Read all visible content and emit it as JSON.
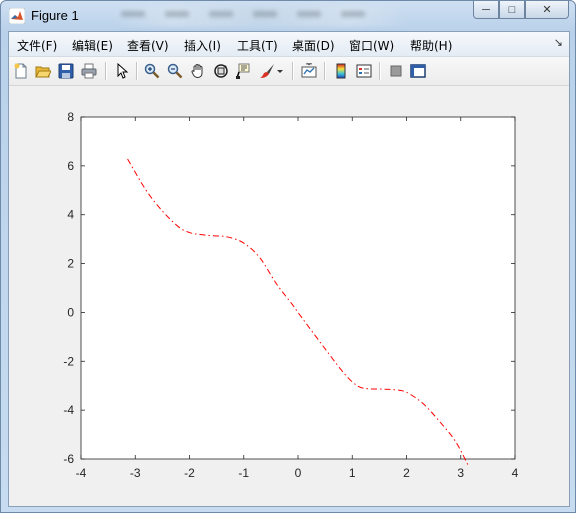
{
  "window": {
    "title": "Figure 1",
    "controls": {
      "minimize": "─",
      "maximize": "□",
      "close": "✕"
    }
  },
  "menubar": {
    "items": [
      {
        "label": "文件(F)"
      },
      {
        "label": "编辑(E)"
      },
      {
        "label": "查看(V)"
      },
      {
        "label": "插入(I)"
      },
      {
        "label": "工具(T)"
      },
      {
        "label": "桌面(D)"
      },
      {
        "label": "窗口(W)"
      },
      {
        "label": "帮助(H)"
      }
    ]
  },
  "toolbar": {
    "buttons": [
      {
        "icon": "new-figure-icon"
      },
      {
        "icon": "open-file-icon"
      },
      {
        "icon": "save-icon"
      },
      {
        "icon": "print-icon"
      },
      {
        "icon": "pointer-icon"
      },
      {
        "icon": "zoom-in-icon"
      },
      {
        "icon": "zoom-out-icon"
      },
      {
        "icon": "pan-hand-icon"
      },
      {
        "icon": "rotate-3d-icon"
      },
      {
        "icon": "data-cursor-icon"
      },
      {
        "icon": "brush-icon"
      },
      {
        "icon": "link-plot-icon"
      },
      {
        "icon": "colorbar-icon"
      },
      {
        "icon": "legend-icon"
      },
      {
        "icon": "hide-plot-tools-icon"
      },
      {
        "icon": "show-plot-tools-icon"
      }
    ]
  },
  "colors": {
    "line": "#ff0000",
    "axes_bg": "#ffffff",
    "figure_bg": "#f0f0f0"
  },
  "chart_data": {
    "type": "line",
    "line_style": "dash-dot",
    "series": [
      {
        "color": "#ff0000",
        "x": [
          -3.1416,
          -2.8,
          -2.5,
          -2.2,
          -2.0,
          -1.8,
          -1.5708,
          -1.3,
          -1.0,
          -0.7,
          -0.4,
          -0.1,
          0.0,
          0.2,
          0.5,
          0.8,
          1.0,
          1.2,
          1.5708,
          1.8,
          2.0,
          2.3,
          2.6,
          2.9,
          3.1416
        ],
        "y": [
          6.28,
          5.0,
          4.15,
          3.5,
          3.27,
          3.19,
          3.14,
          3.09,
          2.84,
          2.23,
          1.18,
          0.31,
          0.0,
          -0.6,
          -1.49,
          -2.36,
          -2.84,
          -3.1,
          -3.14,
          -3.17,
          -3.27,
          -3.72,
          -4.44,
          -5.27,
          -6.28
        ]
      }
    ],
    "xlim": [
      -4,
      4
    ],
    "ylim": [
      -6,
      8
    ],
    "xticks": [
      -4,
      -3,
      -2,
      -1,
      0,
      1,
      2,
      3,
      4
    ],
    "yticks": [
      -6,
      -4,
      -2,
      0,
      2,
      4,
      6,
      8
    ],
    "xlabel": "",
    "ylabel": "",
    "title": "",
    "grid": false
  }
}
